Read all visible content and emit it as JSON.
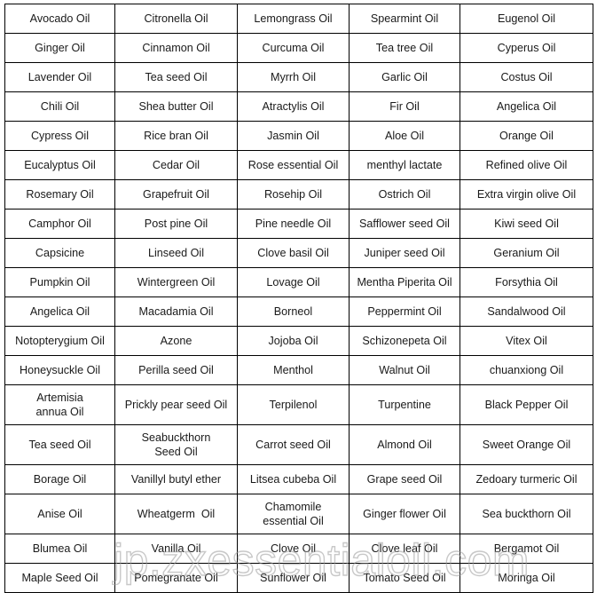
{
  "page": {
    "title": "Essential Oil Product List Table",
    "background_color": "#ffffff",
    "text_color": "#1a1a1a",
    "border_color": "#000000"
  },
  "watermark": {
    "text": "jp.zxessentialoil.com",
    "color": "#9b9b9b",
    "style": "outline"
  },
  "table": {
    "columns": 5,
    "rows": 20,
    "cells": [
      [
        "Avocado Oil",
        "Citronella Oil",
        "Lemongrass Oil",
        "Spearmint Oil",
        "Eugenol Oil"
      ],
      [
        "Ginger Oil",
        "Cinnamon Oil",
        "Curcuma Oil",
        "Tea tree Oil",
        "Cyperus Oil"
      ],
      [
        "Lavender Oil",
        "Tea seed Oil",
        "Myrrh Oil",
        "Garlic Oil",
        "Costus Oil"
      ],
      [
        "Chili Oil",
        "Shea butter Oil",
        "Atractylis Oil",
        "Fir Oil",
        "Angelica Oil"
      ],
      [
        "Cypress Oil",
        "Rice bran Oil",
        "Jasmin Oil",
        "Aloe Oil",
        "Orange Oil"
      ],
      [
        "Eucalyptus Oil",
        "Cedar Oil",
        "Rose essential Oil",
        "menthyl lactate",
        "Refined olive Oil"
      ],
      [
        "Rosemary Oil",
        "Grapefruit Oil",
        "Rosehip Oil",
        "Ostrich Oil",
        "Extra virgin olive Oil"
      ],
      [
        "Camphor Oil",
        "Post pine Oil",
        "Pine needle Oil",
        "Safflower seed Oil",
        "Kiwi seed Oil"
      ],
      [
        "Capsicine",
        "Linseed Oil",
        "Clove basil Oil",
        "Juniper seed Oil",
        "Geranium Oil"
      ],
      [
        "Pumpkin Oil",
        "Wintergreen Oil",
        "Lovage Oil",
        "Mentha Piperita Oil",
        "Forsythia Oil"
      ],
      [
        "Angelica Oil",
        "Macadamia Oil",
        "Borneol",
        "Peppermint Oil",
        "Sandalwood Oil"
      ],
      [
        "Notopterygium Oil",
        "Azone",
        "Jojoba Oil",
        "Schizonepeta Oil",
        "Vitex Oil"
      ],
      [
        "Honeysuckle Oil",
        "Perilla seed Oil",
        "Menthol",
        "Walnut Oil",
        "chuanxiong Oil"
      ],
      [
        "Artemisia\nannua Oil",
        "Prickly pear seed Oil",
        "Terpilenol",
        "Turpentine",
        "Black Pepper Oil"
      ],
      [
        "Tea seed Oil",
        "Seabuckthorn\nSeed Oil",
        "Carrot seed Oil",
        "Almond Oil",
        "Sweet Orange Oil"
      ],
      [
        "Borage Oil",
        "Vanillyl butyl ether",
        "Litsea cubeba Oil",
        "Grape seed Oil",
        "Zedoary turmeric Oil"
      ],
      [
        "Anise Oil",
        "Wheatgerm  Oil",
        "Chamomile\nessential Oil",
        "Ginger flower Oil",
        "Sea buckthorn Oil"
      ],
      [
        "Blumea Oil",
        "Vanilla Oil",
        "Clove Oil",
        "Clove leaf Oil",
        "Bergamot Oil"
      ],
      [
        "Maple Seed Oil",
        "Pomegranate Oil",
        "Sunflower Oil",
        "Tomato Seed Oil",
        "Moringa Oil"
      ]
    ]
  }
}
